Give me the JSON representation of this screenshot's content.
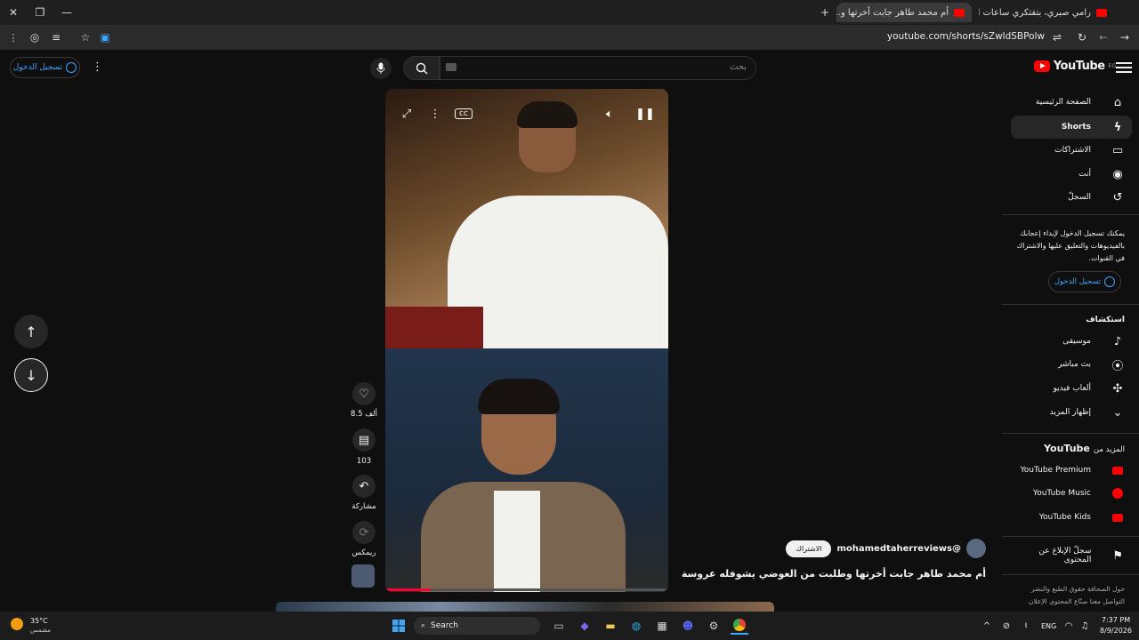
{
  "browser": {
    "tabs": [
      {
        "title": "رامي صبري، بتفتكري ساعات oud",
        "active": false
      },
      {
        "title": "أم محمد طاهر جابت أخرتها و...",
        "active": true
      }
    ],
    "new_tab": "+",
    "url": "youtube.com/shorts/sZwldSBPolw"
  },
  "header": {
    "logo_text": "YouTube",
    "logo_region": "EG",
    "search_placeholder": "بحث",
    "signin_label": "تسجيل الدخول"
  },
  "sidebar": {
    "items": [
      {
        "label": "الصفحة الرئيسية",
        "icon": "home-icon"
      },
      {
        "label": "Shorts",
        "icon": "shorts-icon",
        "selected": true
      },
      {
        "label": "الاشتراكات",
        "icon": "subscriptions-icon"
      },
      {
        "label": "أنت",
        "icon": "you-icon"
      },
      {
        "label": "السجلّ",
        "icon": "history-icon"
      }
    ],
    "signin_prompt": "يمكنك تسجيل الدخول لإبداء إعجابك بالفيديوهات والتعليق عليها والاشتراك في القنوات.",
    "signin_button": "تسجيل الدخول",
    "explore_title": "استكشاف",
    "explore": [
      {
        "label": "موسيقى",
        "icon": "music-icon"
      },
      {
        "label": "بث مباشر",
        "icon": "live-icon"
      },
      {
        "label": "ألعاب فيديو",
        "icon": "gaming-icon"
      },
      {
        "label": "إظهار المزيد",
        "icon": "chevron-down-icon"
      }
    ],
    "more_title_prefix": "المزيد من",
    "more_title_brand": "YouTube",
    "more": [
      {
        "label": "YouTube Premium"
      },
      {
        "label": "YouTube Music"
      },
      {
        "label": "YouTube Kids"
      }
    ],
    "report": "سجلّ الإبلاغ عن المحتوى",
    "footer_line1": "حول  الصحافة  حقوق الطبع والنشر",
    "footer_line2": "التواصل معنا  صنّاع المحتوى  الإعلان"
  },
  "short": {
    "channel": "@mohamedtaherreviews",
    "subscribe": "الاشتراك",
    "title": "أم محمد طاهر جابت أخرتها وطلبت من العوضي يشوفله عروسة",
    "likes": "8.5 ألف",
    "comments": "103",
    "share": "مشاركة",
    "remix": "ريمكس",
    "progress": 0.16
  },
  "taskbar": {
    "weather_temp": "35°C",
    "weather_desc": "مشمس",
    "search": "Search",
    "lang": "ENG",
    "time": "7:37 PM",
    "date": "8/9/2026"
  },
  "colors": {
    "accent": "#3ea6ff",
    "brand": "#ff0000",
    "progress": "#ff0033"
  }
}
